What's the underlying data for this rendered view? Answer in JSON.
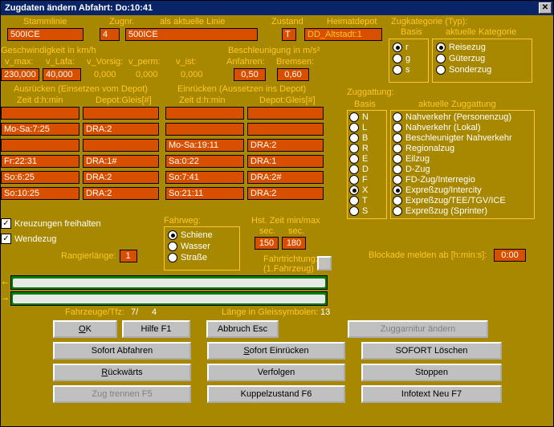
{
  "title": "Zugdaten ändern   Abfahrt: Do:10:41",
  "topRow": {
    "stammlinie_label": "Stammlinie",
    "stammlinie_value": "500ICE",
    "zugnr_label": "Zugnr.",
    "zugnr_value": "4",
    "alslinie_label": "als aktuelle Linie",
    "alslinie_value": "500ICE",
    "zustand_label": "Zustand",
    "zustand_value": "T",
    "heimat_label": "Heimatdepot",
    "heimat_value": "DD_Altstadt:1",
    "zugkat_label": "Zugkategorie (Typ):",
    "basis_label": "Basis",
    "aktuell_label": "aktuelle Kategorie"
  },
  "speed": {
    "title": "Geschwindigkeit in km/h",
    "vmax_label": "v_max:",
    "vmax": "230,000",
    "vlafa_label": "v_Lafa:",
    "vlafa": "40,000",
    "vvorsig_label": "v_Vorsig:",
    "vvorsig": "0,000",
    "vperm_label": "v_perm:",
    "vperm": "0,000",
    "vist_label": "v_ist:",
    "vist": "0,000"
  },
  "accel": {
    "title": "Beschleunigung in m/s²",
    "anfahren_label": "Anfahren:",
    "anfahren": "0,50",
    "bremsen_label": "Bremsen:",
    "bremsen": "0,60"
  },
  "ausruecken": {
    "title": "Ausrücken (Einsetzen vom Depot)",
    "zeit_label": "Zeit  d:h:min",
    "depot_label": "Depot:Gleis[#]",
    "rows": [
      {
        "zeit": "",
        "depot": ""
      },
      {
        "zeit": "Mo-Sa:7:25",
        "depot": "DRA:2"
      },
      {
        "zeit": "",
        "depot": ""
      },
      {
        "zeit": "Fr:22:31",
        "depot": "DRA:1#"
      },
      {
        "zeit": "So:6:25",
        "depot": "DRA:2"
      },
      {
        "zeit": "So:10:25",
        "depot": "DRA:2"
      }
    ]
  },
  "einruecken": {
    "title": "Einrücken (Aussetzen ins Depot)",
    "zeit_label": "Zeit  d:h:min",
    "depot_label": "Depot:Gleis[#]",
    "rows": [
      {
        "zeit": "",
        "depot": ""
      },
      {
        "zeit": "",
        "depot": ""
      },
      {
        "zeit": "Mo-Sa:19:11",
        "depot": "DRA:2"
      },
      {
        "zeit": "Sa:0:22",
        "depot": "DRA:1"
      },
      {
        "zeit": "So:7:41",
        "depot": "DRA:2#"
      },
      {
        "zeit": "So:21:11",
        "depot": "DRA:2"
      }
    ]
  },
  "kreuzungen": "Kreuzungen freihalten",
  "wendezug": "Wendezug",
  "rangier_label": "Rangierlänge:",
  "rangier_value": "1",
  "fahrweg": {
    "title": "Fahrweg:",
    "schiene": "Schiene",
    "wasser": "Wasser",
    "strasse": "Straße"
  },
  "hst": {
    "title": "Hst. Zeit min/max",
    "sec1": "sec.",
    "sec2": "sec.",
    "min": "150",
    "max": "180"
  },
  "fahrtrichtung": {
    "label": "Fahrtrichtung:",
    "sub": "(1.Fahrzeug)"
  },
  "zuggattung": {
    "title": "Zuggattung:",
    "basis": "Basis",
    "aktuell": "aktuelle Zuggattung",
    "items": [
      {
        "code": "N",
        "label": "Nahverkehr (Personenzug)"
      },
      {
        "code": "L",
        "label": "Nahverkehr (Lokal)"
      },
      {
        "code": "B",
        "label": "Beschleunigter Nahverkehr"
      },
      {
        "code": "R",
        "label": "Regionalzug"
      },
      {
        "code": "E",
        "label": "Eilzug"
      },
      {
        "code": "D",
        "label": "D-Zug"
      },
      {
        "code": "F",
        "label": "FD-Zug/Interregio"
      },
      {
        "code": "X",
        "label": "Expreßzug/Intercity"
      },
      {
        "code": "T",
        "label": "Expreßzug/TEE/TGV/ICE"
      },
      {
        "code": "S",
        "label": "Expreßzug (Sprinter)"
      }
    ]
  },
  "kategorie": {
    "r": "r",
    "g": "g",
    "s": "s",
    "reise": "Reisezug",
    "gueter": "Güterzug",
    "sonder": "Sonderzug"
  },
  "blockade_label": "Blockade melden ab [h:min:s]:",
  "blockade_value": "0:00",
  "bottom": {
    "fahrzeuge_label": "Fahrzeuge/Tfz:",
    "fahrzeuge_v1": "7/",
    "fahrzeuge_v2": "4",
    "laenge_label": "Länge in Gleissymbolen:",
    "laenge_value": "13"
  },
  "buttons": {
    "ok": "OK",
    "hilfe": "Hilfe     F1",
    "abbruch": "Abbruch  Esc",
    "zuggarnitur": "Zuggarnitur ändern",
    "sofortab": "Sofort Abfahren",
    "soforte": "Sofort Einrücken",
    "sofortl": "SOFORT Löschen",
    "rueckwaerts": "Rückwärts",
    "verfolgen": "Verfolgen",
    "stoppen": "Stoppen",
    "zugtrennen": "Zug trennen      F5",
    "kuppel": "Kuppelzustand   F6",
    "infotext": "Infotext Neu    F7"
  }
}
